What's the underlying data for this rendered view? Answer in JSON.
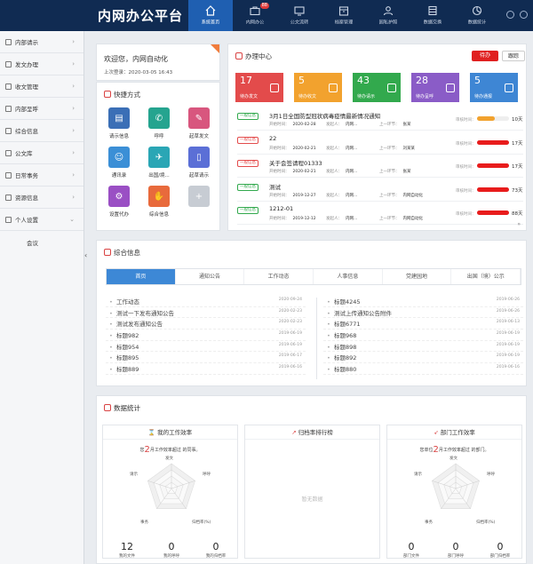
{
  "app": {
    "title": "内网办公平台"
  },
  "nav": [
    {
      "label": "系统首页"
    },
    {
      "label": "内网办公",
      "badge": "88"
    },
    {
      "label": "公文流转"
    },
    {
      "label": "档案管理"
    },
    {
      "label": "园私护照"
    },
    {
      "label": "数据交换"
    },
    {
      "label": "数据统计"
    }
  ],
  "sidebar": {
    "items": [
      {
        "label": "内部请示"
      },
      {
        "label": "发文办理"
      },
      {
        "label": "收文管理"
      },
      {
        "label": "内部呈呼"
      },
      {
        "label": "综合信息"
      },
      {
        "label": "公文库"
      },
      {
        "label": "日常事务"
      },
      {
        "label": "资源信息"
      },
      {
        "label": "个人设置"
      }
    ],
    "sub_item": "会议"
  },
  "welcome": {
    "greeting": "欢迎您，内网自动化",
    "last_login_label": "上次登录：",
    "last_login": "2020-03-05 16:43"
  },
  "quick": {
    "title": "快捷方式",
    "items": [
      {
        "label": "请示信息",
        "icon": "document-icon",
        "color": "#3b6fb6"
      },
      {
        "label": "呼呼",
        "icon": "phone-icon",
        "color": "#25a48f"
      },
      {
        "label": "起草发文",
        "icon": "edit-icon",
        "color": "#d8567e"
      },
      {
        "label": "通讯录",
        "icon": "contacts-icon",
        "color": "#3b8fd6"
      },
      {
        "label": "出国/境...",
        "icon": "plane-icon",
        "color": "#2aa6b5"
      },
      {
        "label": "起草请示",
        "icon": "draft-icon",
        "color": "#5b6fd6"
      },
      {
        "label": "设置代办",
        "icon": "gear-icon",
        "color": "#9a4fc4"
      },
      {
        "label": "综合信息",
        "icon": "hand-icon",
        "color": "#e86a3c"
      },
      {
        "label": "",
        "icon": "plus-icon",
        "color": "#c7ccd3"
      }
    ]
  },
  "office": {
    "title": "办理中心",
    "btn_todo": "待办",
    "btn_track": "跟踪",
    "stats": [
      {
        "num": "17",
        "label": "待办发文",
        "color": "#e34b4b"
      },
      {
        "num": "5",
        "label": "待办收文",
        "color": "#f2a22e"
      },
      {
        "num": "43",
        "label": "待办请示",
        "color": "#32a94d"
      },
      {
        "num": "28",
        "label": "待办呈呼",
        "color": "#8a5cc7"
      },
      {
        "num": "5",
        "label": "待办通报",
        "color": "#3e86d4"
      }
    ],
    "tasks": [
      {
        "tag": "一般信息",
        "tag_color": "#32a94d",
        "title": "3月1日全国防型冠状病毒疫情最新情况通知",
        "date_label": "开始时间：",
        "date": "2020-02-28",
        "from_label": "发起人：",
        "from": "内网...",
        "prev_label": "上一环节：",
        "prev": "张某",
        "dl": "审核时间：",
        "pct": 0.55,
        "bar_color": "#f2a22e",
        "days": "10天"
      },
      {
        "tag": "一般信息",
        "tag_color": "#e34b4b",
        "title": "22",
        "date_label": "开始时间：",
        "date": "2020-02-21",
        "from_label": "发起人：",
        "from": "内网...",
        "prev_label": "上一环节：",
        "prev": "刘某某",
        "dl": "审核时间：",
        "pct": 1.0,
        "bar_color": "#e81c1c",
        "days": "17天"
      },
      {
        "tag": "一般信息",
        "tag_color": "#e34b4b",
        "title": "关于会签请程01333",
        "date_label": "开始时间：",
        "date": "2020-02-21",
        "from_label": "发起人：",
        "from": "内网...",
        "prev_label": "上一环节：",
        "prev": "张某",
        "dl": "审核时间：",
        "pct": 1.0,
        "bar_color": "#e81c1c",
        "days": "17天"
      },
      {
        "tag": "一般信息",
        "tag_color": "#32a94d",
        "title": "测试",
        "date_label": "开始时间：",
        "date": "2019-12-27",
        "from_label": "发起人：",
        "from": "内网...",
        "prev_label": "上一环节：",
        "prev": "内网自动化",
        "dl": "审核时间：",
        "pct": 1.0,
        "bar_color": "#e81c1c",
        "days": "73天"
      },
      {
        "tag": "一般信息",
        "tag_color": "#32a94d",
        "title": "1212-01",
        "date_label": "开始时间：",
        "date": "2019-12-12",
        "from_label": "发起人：",
        "from": "内网...",
        "prev_label": "上一环节：",
        "prev": "内网自动化",
        "dl": "审核时间：",
        "pct": 1.0,
        "bar_color": "#e81c1c",
        "days": "88天"
      }
    ],
    "more": "»"
  },
  "info": {
    "title": "综合信息",
    "tabs": [
      "首页",
      "通知公告",
      "工作动态",
      "人事信息",
      "党建园地",
      "出国（境）公示"
    ],
    "left": [
      {
        "text": "工作动态",
        "date": "2020-09-24"
      },
      {
        "text": "测试一下发布通知公告",
        "date": "2020-02-23"
      },
      {
        "text": "测试发布通知公告",
        "date": "2020-02-23"
      },
      {
        "text": "标题982",
        "date": "2019-06-19"
      },
      {
        "text": "标题954",
        "date": "2019-06-19"
      },
      {
        "text": "标题895",
        "date": "2019-06-17"
      },
      {
        "text": "标题889",
        "date": "2019-06-16"
      }
    ],
    "right": [
      {
        "text": "标题4245",
        "date": "2019-06-26"
      },
      {
        "text": "测试上传通知公告附件",
        "date": "2019-06-26"
      },
      {
        "text": "标题6771",
        "date": "2019-06-13"
      },
      {
        "text": "标题968",
        "date": "2019-06-19"
      },
      {
        "text": "标题898",
        "date": "2019-06-19"
      },
      {
        "text": "标题892",
        "date": "2019-06-19"
      },
      {
        "text": "标题880",
        "date": "2019-06-16"
      }
    ]
  },
  "stats": {
    "title": "数据统计",
    "my_eff": {
      "title": "我的工作效率",
      "sub_pre": "您",
      "sub_num": "2",
      "sub_post": "月工作效率超过 的同事。",
      "axes": [
        "发文",
        "呼呼",
        "归档率(%)",
        "事务",
        "请示"
      ],
      "metrics": [
        {
          "v": "12",
          "k": "我的文件"
        },
        {
          "v": "0",
          "k": "我的呼呼"
        },
        {
          "v": "0",
          "k": "我的归档率"
        }
      ]
    },
    "archive": {
      "title": "归档率排行榜",
      "empty": "暂无数据"
    },
    "dept_eff": {
      "title": "部门工作效率",
      "sub_pre": "您单位",
      "sub_num": "2",
      "sub_post": "月工作效率超过 的部门。",
      "axes": [
        "发文",
        "呼呼",
        "归档率(%)",
        "事务",
        "请示"
      ],
      "metrics": [
        {
          "v": "0",
          "k": "部门文件"
        },
        {
          "v": "0",
          "k": "部门呼呼"
        },
        {
          "v": "0",
          "k": "部门归档率"
        }
      ]
    }
  }
}
